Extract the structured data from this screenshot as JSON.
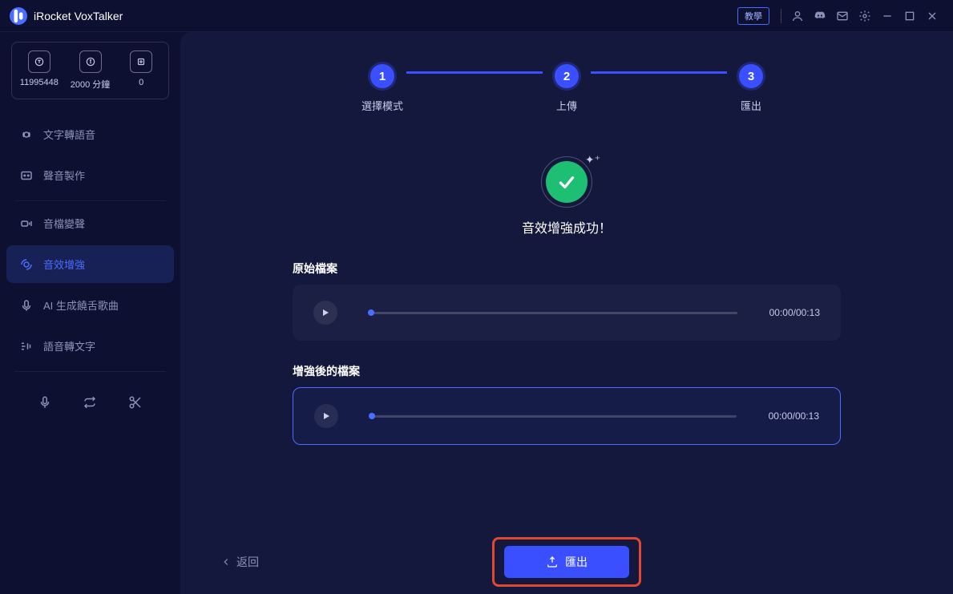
{
  "app": {
    "title": "iRocket VoxTalker",
    "tutorial_label": "教學"
  },
  "credits": {
    "slot1_value": "11995448",
    "slot2_value": "2000 分鐘",
    "slot3_value": "0"
  },
  "sidebar": {
    "items": [
      {
        "label": "文字轉語音"
      },
      {
        "label": "聲音製作"
      },
      {
        "label": "音檔變聲"
      },
      {
        "label": "音效增強"
      },
      {
        "label": "AI 生成饒舌歌曲"
      },
      {
        "label": "語音轉文字"
      }
    ]
  },
  "stepper": {
    "step1": {
      "num": "1",
      "label": "選擇模式"
    },
    "step2": {
      "num": "2",
      "label": "上傳"
    },
    "step3": {
      "num": "3",
      "label": "匯出"
    }
  },
  "success": {
    "message": "音效增強成功！"
  },
  "original": {
    "label": "原始檔案",
    "time": "00:00/00:13"
  },
  "enhanced": {
    "label": "增強後的檔案",
    "time": "00:00/00:13"
  },
  "footer": {
    "back_label": "返回",
    "export_label": "匯出"
  }
}
